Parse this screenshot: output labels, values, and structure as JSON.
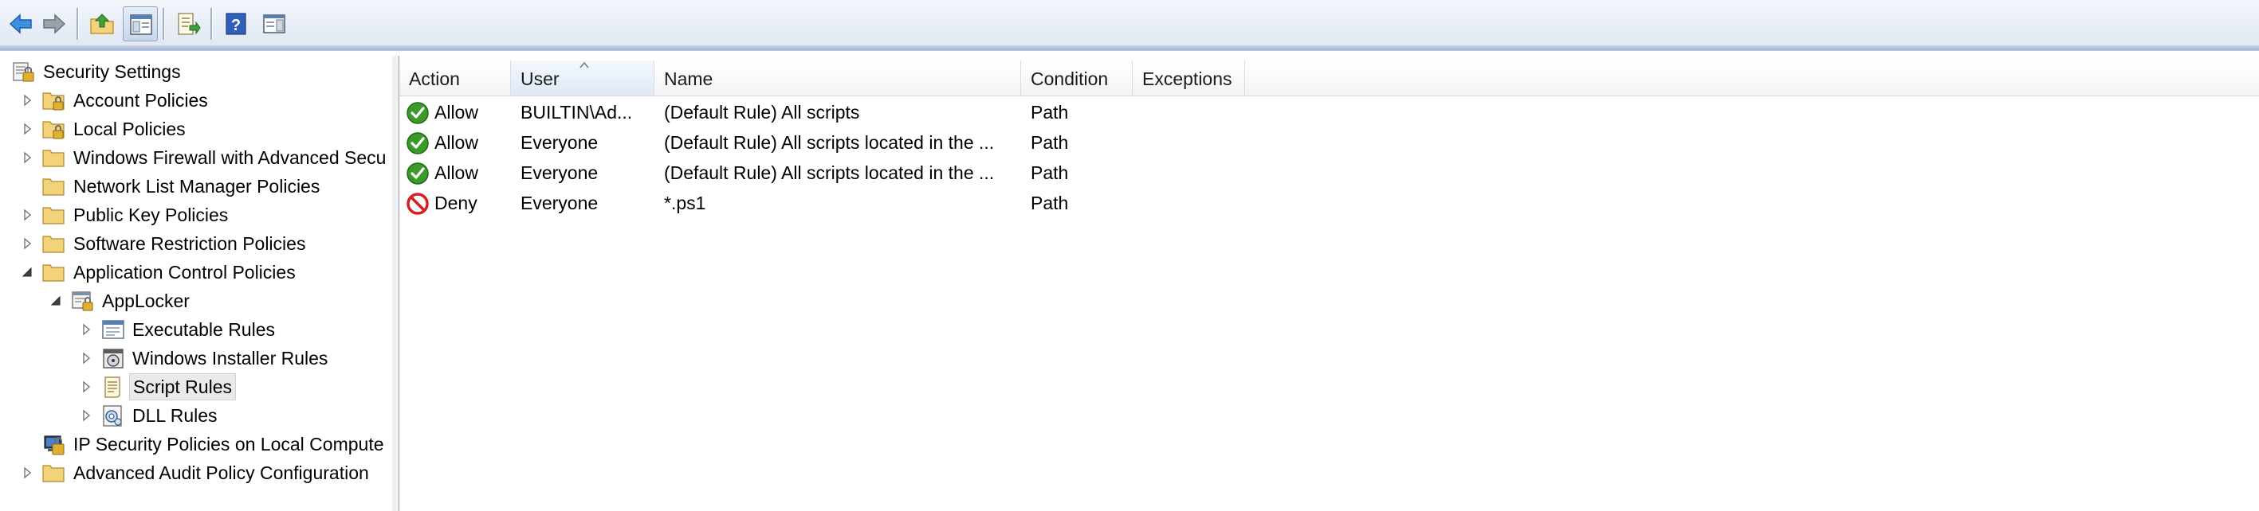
{
  "toolbar": {
    "buttons": [
      {
        "name": "back-button",
        "icon": "arrow-left-icon"
      },
      {
        "name": "forward-button",
        "icon": "arrow-right-icon"
      },
      {
        "name": "up-one-level-button",
        "icon": "folder-up-icon"
      },
      {
        "name": "show-hide-console-tree-button",
        "icon": "console-tree-icon"
      },
      {
        "name": "export-list-button",
        "icon": "export-list-icon"
      },
      {
        "name": "help-button",
        "icon": "help-icon"
      },
      {
        "name": "show-hide-action-pane-button",
        "icon": "action-pane-icon"
      }
    ]
  },
  "tree": {
    "items": [
      {
        "label": "Security Settings",
        "icon": "security-settings-icon",
        "expander": "none"
      },
      {
        "label": "Account Policies",
        "icon": "policy-folder-icon",
        "expander": "collapsed"
      },
      {
        "label": "Local Policies",
        "icon": "policy-folder-icon",
        "expander": "collapsed"
      },
      {
        "label": "Windows Firewall with Advanced Secu",
        "icon": "folder-icon",
        "expander": "collapsed"
      },
      {
        "label": "Network List Manager Policies",
        "icon": "folder-icon",
        "expander": "none"
      },
      {
        "label": "Public Key Policies",
        "icon": "folder-icon",
        "expander": "collapsed"
      },
      {
        "label": "Software Restriction Policies",
        "icon": "folder-icon",
        "expander": "collapsed"
      },
      {
        "label": "Application Control Policies",
        "icon": "folder-icon",
        "expander": "expanded"
      },
      {
        "label": "AppLocker",
        "icon": "applocker-icon",
        "expander": "expanded"
      },
      {
        "label": "Executable Rules",
        "icon": "executable-rules-icon",
        "expander": "collapsed"
      },
      {
        "label": "Windows Installer Rules",
        "icon": "installer-rules-icon",
        "expander": "collapsed"
      },
      {
        "label": "Script Rules",
        "icon": "script-rules-icon",
        "expander": "collapsed",
        "selected": true
      },
      {
        "label": "DLL Rules",
        "icon": "dll-rules-icon",
        "expander": "collapsed"
      },
      {
        "label": "IP Security Policies on Local Compute",
        "icon": "ip-security-icon",
        "expander": "none"
      },
      {
        "label": "Advanced Audit Policy Configuration",
        "icon": "folder-icon",
        "expander": "collapsed"
      }
    ]
  },
  "list": {
    "columns": [
      "Action",
      "User",
      "Name",
      "Condition",
      "Exceptions"
    ],
    "sorted_column": "User",
    "rows": [
      {
        "action": "Allow",
        "status": "allow-icon",
        "user": "BUILTIN\\Ad...",
        "name": "(Default Rule) All scripts",
        "condition": "Path",
        "exceptions": ""
      },
      {
        "action": "Allow",
        "status": "allow-icon",
        "user": "Everyone",
        "name": "(Default Rule) All scripts located in the ...",
        "condition": "Path",
        "exceptions": ""
      },
      {
        "action": "Allow",
        "status": "allow-icon",
        "user": "Everyone",
        "name": "(Default Rule) All scripts located in the ...",
        "condition": "Path",
        "exceptions": ""
      },
      {
        "action": "Deny",
        "status": "deny-icon",
        "user": "Everyone",
        "name": "*.ps1",
        "condition": "Path",
        "exceptions": ""
      }
    ]
  },
  "colors": {
    "allow": "#3a9a2a",
    "deny": "#d42020",
    "folder": "#f2d27a",
    "selection": "#eaeaea"
  }
}
